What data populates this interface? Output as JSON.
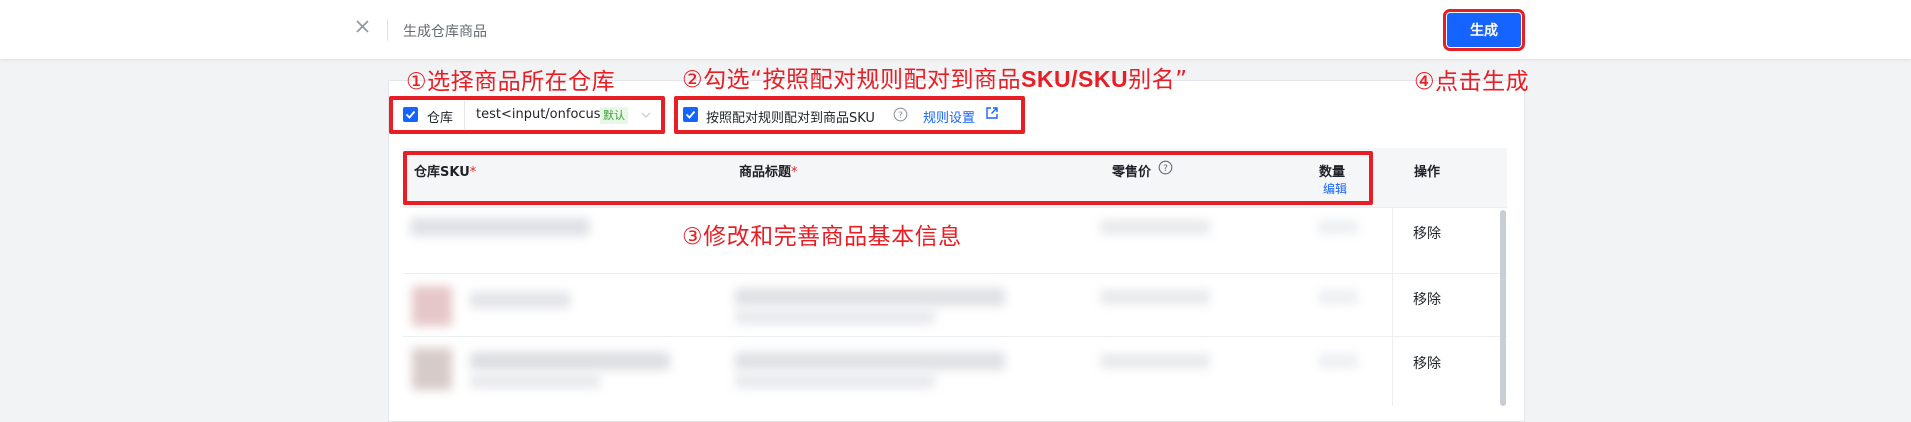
{
  "header": {
    "title": "生成仓库商品",
    "generate_label": "生成"
  },
  "annotations": {
    "step1": "①选择商品所在仓库",
    "step2_prefix": "②勾选“按照配对规则配对到商品",
    "step2_sku": "SKU/SKU",
    "step2_suffix": "别名”",
    "step3": "③修改和完善商品基本信息",
    "step4": "④点击生成"
  },
  "warehouse": {
    "label": "仓库",
    "value": "test<input/onfocus=",
    "default_tag": "默认",
    "checked": true
  },
  "pairing": {
    "label": "按照配对规则配对到商品SKU",
    "rule_link": "规则设置",
    "checked": true
  },
  "table": {
    "columns": {
      "sku": "仓库SKU",
      "title": "商品标题",
      "price": "零售价",
      "qty": "数量",
      "qty_edit": "编辑",
      "action": "操作"
    },
    "rows": [
      {
        "action": "移除"
      },
      {
        "action": "移除"
      },
      {
        "action": "移除"
      }
    ]
  },
  "colors": {
    "primary": "#1664ff",
    "annotation_red": "#e81e25",
    "tag_green": "#3aa335"
  }
}
